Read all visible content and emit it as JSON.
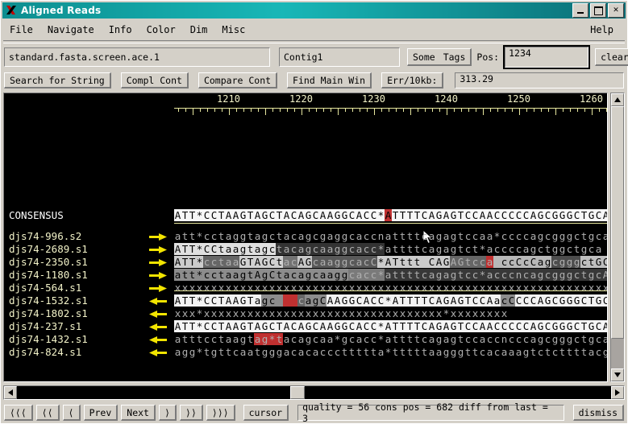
{
  "window": {
    "title": "Aligned Reads",
    "icon": "x-app-icon",
    "buttons": {
      "minimize": "minimize-button",
      "maximize": "maximize-button",
      "close": "✕"
    }
  },
  "menubar": {
    "items": [
      "File",
      "Navigate",
      "Info",
      "Color",
      "Dim",
      "Misc"
    ],
    "help": "Help"
  },
  "toolbar": {
    "filename": "standard.fasta.screen.ace.1",
    "contig": "Contig1",
    "some_label": "Some",
    "tags_label": "Tags",
    "pos_label": "Pos:",
    "pos_value": "1234",
    "clear_label": "clear",
    "search_label": "Search for String",
    "compl_cont_label": "Compl Cont",
    "compare_cont_label": "Compare Cont",
    "find_main_win_label": "Find Main Win",
    "err_label": "Err/10kb:",
    "err_value": "313.29"
  },
  "alignment": {
    "ruler_labels": [
      "1210",
      "1220",
      "1230",
      "1240",
      "1250",
      "1260"
    ],
    "ruler_start": 1203,
    "consensus_name": "CONSENSUS",
    "consensus_bases": "ATT*CCTAAGTAGCTACAGCAAGGCACC*ATTTTCAGAGTCCAACCCCCAGCGGGCTGCA",
    "consensus_highlight_index": 29,
    "reads": [
      {
        "name": "djs74-996.s2",
        "direction": "forward",
        "bases": "att*cctaggtagctacagcgaggcaccnattttcagagtccaa*ccccagcgggctgca",
        "shades": [],
        "reds": []
      },
      {
        "name": "djs74-2689.s1",
        "direction": "forward",
        "bases": "ATT*CCtaagtagctacagcaaggcacc*attttcagagtct*accccagctggctgca",
        "shades": [
          [
            0,
            14,
            0.88
          ],
          [
            14,
            29,
            0.2
          ]
        ],
        "reds": []
      },
      {
        "name": "djs74-2350.s1",
        "direction": "forward",
        "bases": "ATT*cctaaGTAGCtacAGcaaggcacC*ATttt CAGAGtcca ccCcCagcgggctGCA",
        "shades": [
          [
            0,
            4,
            0.8
          ],
          [
            4,
            9,
            0.4
          ],
          [
            9,
            15,
            0.82
          ],
          [
            15,
            17,
            0.45
          ],
          [
            17,
            19,
            0.78
          ],
          [
            19,
            28,
            0.35
          ],
          [
            28,
            38,
            0.8
          ],
          [
            38,
            44,
            0.4
          ],
          [
            44,
            52,
            0.72
          ],
          [
            52,
            56,
            0.3
          ],
          [
            56,
            60,
            0.75
          ]
        ],
        "reds": [
          [
            43,
            44
          ]
        ]
      },
      {
        "name": "djs74-1180.s1",
        "direction": "forward",
        "bases": "att*cctaagtAgCtacagcaaggcacc*attttcagagtcc*acccncagcgggctgcA",
        "shades": [
          [
            0,
            24,
            0.55
          ],
          [
            24,
            29,
            0.48
          ],
          [
            29,
            60,
            0.22
          ]
        ],
        "reds": []
      },
      {
        "name": "djs74-564.s1",
        "direction": "forward",
        "bases": "xxxxxxxxxxxxxxxxxxxxxxxxxxxxxxxxxxxxxxxxxxxxxxxxxxxxxxxxxxxx",
        "shades": [],
        "reds": []
      },
      {
        "name": "djs74-1532.s1",
        "direction": "reverse",
        "bases": "ATT*CCTAAGTagc   cagCAAGGCACC*ATTTTCAGAGTCCAacCCCCAGCGGGCTGCA",
        "shades": [
          [
            0,
            12,
            0.95
          ],
          [
            12,
            16,
            0.55
          ],
          [
            16,
            18,
            0.4
          ],
          [
            18,
            21,
            0.55
          ],
          [
            21,
            45,
            0.95
          ],
          [
            45,
            47,
            0.55
          ],
          [
            47,
            60,
            0.95
          ]
        ],
        "reds": [
          [
            15,
            17
          ]
        ]
      },
      {
        "name": "djs74-1802.s1",
        "direction": "reverse",
        "bases": "xxx*xxxxxxxxxxxxxxxxxxxxxxxxxxxxxxxxx*xxxxxxxx",
        "shades": [],
        "reds": []
      },
      {
        "name": "djs74-237.s1",
        "direction": "reverse",
        "bases": "ATT*CCTAAGTAGCTACAGCAAGGCACC*ATTTTCAGAGTCCAACCCCCAGCGGGCTGCA",
        "shades": [
          [
            0,
            60,
            0.96
          ]
        ],
        "reds": []
      },
      {
        "name": "djs74-1432.s1",
        "direction": "reverse",
        "bases": "atttcctaagtag*tacagcaa*gcacc*attttcagagtccaccncccagcgggctgca",
        "shades": [],
        "reds": [
          [
            11,
            15
          ]
        ]
      },
      {
        "name": "djs74-824.s1",
        "direction": "reverse",
        "bases": "agg*tgttcaatgggacacacccttttta*tttttaagggttcacaaagtctcttttacgg",
        "shades": [],
        "reds": []
      }
    ]
  },
  "nav": {
    "buttons": [
      "⟨⟨⟨",
      "⟨⟨",
      "⟨",
      "Prev",
      "Next",
      "⟩",
      "⟩⟩",
      "⟩⟩⟩"
    ],
    "cursor_label": "cursor",
    "status": "quality = 56 cons pos = 682 diff from last = 3",
    "dismiss_label": "dismiss"
  },
  "colors": {
    "titlebar_teal": "#18b7b7",
    "face": "#d4d0c8",
    "canvas_bg": "#000000",
    "ruler_yellow": "#e8e8a0",
    "arrow_yellow": "#f2e400",
    "highlight_red": "#c03030",
    "base_gray": "#b0b0b0"
  }
}
